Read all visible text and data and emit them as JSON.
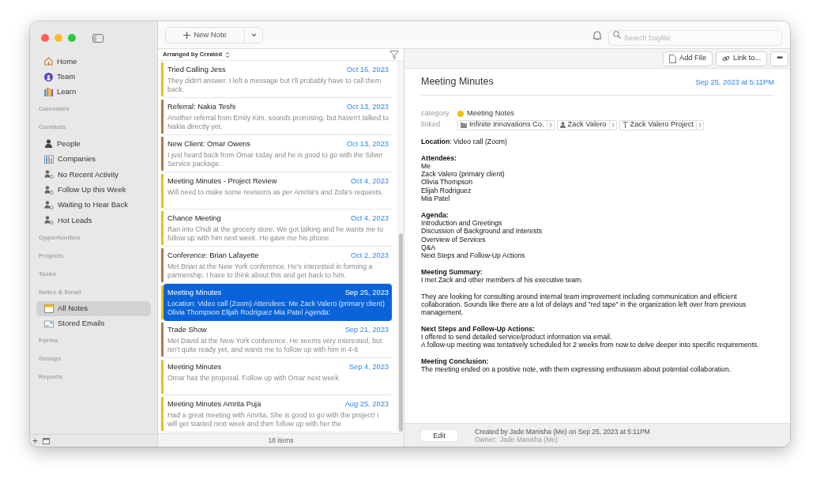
{
  "toolbar": {
    "new_button": "New Note",
    "search": {
      "placeholder": "Search Daylite"
    }
  },
  "sidebar": {
    "groups": [
      {
        "items": [
          {
            "label": "Home",
            "kind": "home",
            "selected": false
          },
          {
            "label": "Team",
            "kind": "team",
            "selected": false
          },
          {
            "label": "Learn",
            "kind": "learn",
            "selected": false
          }
        ]
      },
      {
        "heading": "Calendars"
      },
      {
        "heading": "Contacts",
        "items": [
          {
            "label": "People",
            "kind": "person",
            "selected": false
          },
          {
            "label": "Companies",
            "kind": "company",
            "selected": false
          },
          {
            "label": "No Recent Activity",
            "kind": "smart",
            "selected": false
          },
          {
            "label": "Follow Up this Week",
            "kind": "smart",
            "selected": false
          },
          {
            "label": "Waiting to Hear Back",
            "kind": "smart",
            "selected": false
          },
          {
            "label": "Hot Leads",
            "kind": "smart",
            "selected": false
          }
        ]
      },
      {
        "heading": "Opportunities"
      },
      {
        "heading": "Projects"
      },
      {
        "heading": "Tasks"
      },
      {
        "heading": "Notes & Email",
        "items": [
          {
            "label": "All Notes",
            "kind": "note",
            "selected": true
          },
          {
            "label": "Stored Emails",
            "kind": "email",
            "selected": false
          }
        ]
      },
      {
        "heading": "Forms"
      },
      {
        "heading": "Groups"
      },
      {
        "heading": "Reports"
      }
    ],
    "add": "+"
  },
  "note_list": {
    "sort_label": "Arranged by Created",
    "notes": [
      {
        "title": "Tried Calling Jess",
        "date": "Oct 16, 2023",
        "preview": "They didn't answer. I left a message but I'll probably have to call them back.",
        "color": "#f0c000",
        "selected": false
      },
      {
        "title": "Referral: Nakia Teshi",
        "date": "Oct 13, 2023",
        "preview": "Another referral from Emily Kim, sounds promising, but haven't talked to Nakia directly yet.",
        "color": "#b27a42",
        "selected": false
      },
      {
        "title": "New Client: Omar Owens",
        "date": "Oct 13, 2023",
        "preview": "I just heard back from Omar today and he is good to go with the Silver Service package.",
        "color": "#b27a42",
        "selected": false
      },
      {
        "title": "Meeting Minutes - Project Review",
        "date": "Oct 4, 2023",
        "preview": "Will need to make some revisions as per Amrita's and Zola's requests.",
        "color": "#f0c000",
        "selected": false
      },
      {
        "title": "Chance Meeting",
        "date": "Oct 4, 2023",
        "preview": "Ran into Chidi at the grocery store. We got talking and he wants me to follow up with him next week. He gave me his phone",
        "color": "#f0c000",
        "selected": false
      },
      {
        "title": "Conference: Brian Lafayette",
        "date": "Oct 2, 2023",
        "preview": "Met Brian at the New York conference. He's interested in forming a partnership. I have to think about this and get back to him.",
        "color": "#b27a42",
        "selected": false
      },
      {
        "title": "Meeting Minutes",
        "date": "Sep 25, 2023",
        "preview": "Location: Video call (Zoom) Attendees: Me Zack Valero (primary client) Olivia Thompson Elijah Rodriguez Mia Patel Agenda:",
        "color": "#f0c000",
        "selected": true
      },
      {
        "title": "Trade Show",
        "date": "Sep 21, 2023",
        "preview": "Met David at the New York conference. He seems very interested, but isn't quite ready yet, and wants me to follow up with him in 4-6",
        "color": "#b27a42",
        "selected": false
      },
      {
        "title": "Meeting Minutes",
        "date": "Sep 4, 2023",
        "preview": "Omar has the proposal. Follow up with Omar next week.",
        "color": "#f0c000",
        "selected": false
      },
      {
        "title": "Meeting Minutes Amrita Puja",
        "date": "Aug 25, 2023",
        "preview": "Had a great meeting with Amrita. She is good to go with the project! I will get started next week and then follow up with her the",
        "color": "#f0c000",
        "selected": false
      }
    ],
    "count": "18 items"
  },
  "detail": {
    "buttons": [
      {
        "label": "Add File",
        "kind": "file"
      },
      {
        "label": "Link to...",
        "kind": "link"
      },
      {
        "label": "•••",
        "kind": "more"
      }
    ],
    "title": "Meeting Minutes",
    "date": "Sep 25, 2023 at 5:11PM",
    "category_label": "category",
    "category": {
      "label": "Meeting Notes",
      "color": "#f0c000"
    },
    "linked_label": "linked",
    "links": [
      {
        "label": "Infinite Innovations Co.",
        "kind": "company"
      },
      {
        "label": "Zack Valero",
        "kind": "person"
      },
      {
        "label": "Zack Valero Project",
        "kind": "project"
      }
    ],
    "body": [
      {
        "lines": [
          "**Location**: Video call (Zoom)"
        ]
      },
      {
        "heading": "Attendees:",
        "lines": [
          "Me",
          "Zack Valero (primary client)",
          "Olivia Thompson",
          "Elijah Rodriguez",
          "Mia Patel"
        ]
      },
      {
        "heading": "Agenda:",
        "lines": [
          "Introduction and Greetings",
          "Discussion of Background and Interests",
          "Overview of Services",
          "Q&A",
          "Next Steps and Follow-Up Actions"
        ]
      },
      {
        "heading": "Meeting Summary:",
        "lines": [
          "I met Zack and other members of his executive team."
        ]
      },
      {
        "lines": [
          "They are looking for consulting around internal team improvement including communication and efficient collaboration. Sounds like there are a lot of delays and \"red tape\" in the organization left over from previous management."
        ]
      },
      {
        "heading": "Next Steps and Follow-Up Actions:",
        "lines": [
          "I offered to send detailed service/product information via email.",
          "A follow-up meeting was tentatively scheduled for 2 weeks from now to delve deeper into specific requirements."
        ]
      },
      {
        "heading": "Meeting Conclusion:",
        "lines": [
          "The meeting ended on a positive note, with them expressing enthusiasm about potential collaboration."
        ]
      }
    ],
    "edit": "Edit",
    "created": "Created by Jade Manisha (Me) on Sep 25, 2023 at 5:11PM",
    "owner": "Owner:  Jade Manisha (Me)"
  }
}
